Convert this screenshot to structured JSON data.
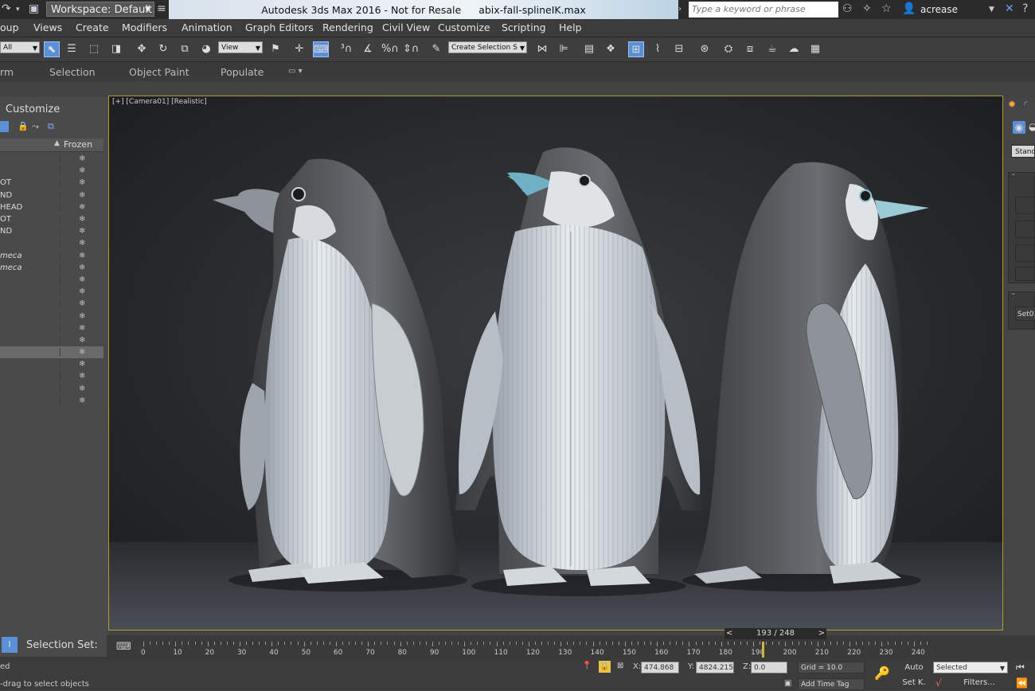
{
  "window": {
    "workspace_label": "Workspace: Default",
    "title_app": "Autodesk 3ds Max 2016 - Not for Resale",
    "title_file": "abix-fall-splineIK.max",
    "search_placeholder": "Type a keyword or phrase",
    "user": "acrease"
  },
  "menu": [
    "oup",
    "Views",
    "Create",
    "Modifiers",
    "Animation",
    "Graph Editors",
    "Rendering",
    "Civil View",
    "Customize",
    "Scripting",
    "Help"
  ],
  "toolbar": {
    "filter_value": "All",
    "ref_coord_value": "View",
    "selection_set_value": "Create Selection S"
  },
  "ribbon": [
    "rm",
    "Selection",
    "Object Paint",
    "Populate"
  ],
  "explorer": {
    "title": "Customize",
    "frozen_header": "Frozen",
    "rows": [
      {
        "name": ""
      },
      {
        "name": ""
      },
      {
        "name": "OT"
      },
      {
        "name": "ND"
      },
      {
        "name": "HEAD"
      },
      {
        "name": "OT"
      },
      {
        "name": "ND"
      },
      {
        "name": ""
      },
      {
        "name": "meca"
      },
      {
        "name": "meca"
      },
      {
        "name": ""
      },
      {
        "name": ""
      },
      {
        "name": ""
      },
      {
        "name": ""
      },
      {
        "name": ""
      },
      {
        "name": ""
      },
      {
        "name": ""
      },
      {
        "name": ""
      },
      {
        "name": ""
      },
      {
        "name": ""
      },
      {
        "name": ""
      }
    ],
    "frozen_glyph": "❄"
  },
  "viewport": {
    "label": "[+] [Camera01] [Realistic]"
  },
  "command_panel": {
    "dropdown_value": "Standa",
    "selection_value": "Set01"
  },
  "timeline": {
    "selection_set_label": "Selection Set:",
    "frame_display": "193 / 248",
    "current_frame": 193,
    "ticks": [
      "0",
      "10",
      "20",
      "30",
      "40",
      "50",
      "60",
      "70",
      "80",
      "90",
      "100",
      "110",
      "120",
      "130",
      "140",
      "150",
      "160",
      "170",
      "180",
      "190",
      "200",
      "210",
      "220",
      "230",
      "240"
    ]
  },
  "status": {
    "left_top": "ed",
    "prompt": "-drag to select objects",
    "x_label": "X:",
    "x_value": "474.868",
    "y_label": "Y:",
    "y_value": "4824.215",
    "z_label": "Z:",
    "z_value": "0.0",
    "grid": "Grid = 10.0",
    "add_time_tag": "Add Time Tag",
    "auto_label": "Auto",
    "setk_label": "Set K.",
    "selected_value": "Selected",
    "filters_label": "Filters..."
  }
}
